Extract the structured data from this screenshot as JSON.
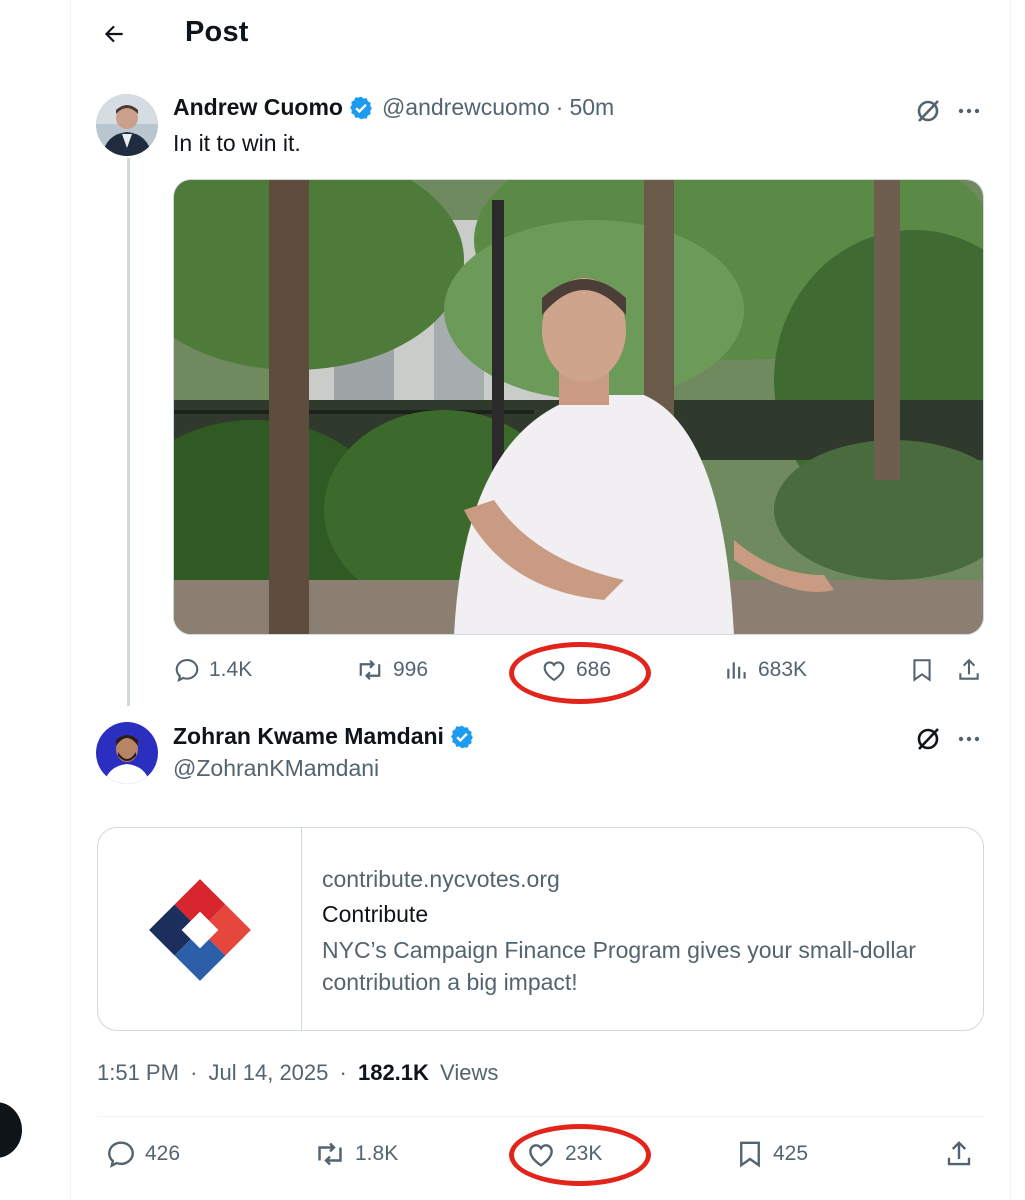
{
  "header": {
    "title": "Post"
  },
  "tweet1": {
    "name": "Andrew Cuomo",
    "handle": "@andrewcuomo",
    "separator": "·",
    "time": "50m",
    "text": "In it to win it.",
    "stats": {
      "replies": "1.4K",
      "reposts": "996",
      "likes": "686",
      "views": "683K"
    }
  },
  "tweet2": {
    "name": "Zohran Kwame Mamdani",
    "handle": "@ZohranKMamdani",
    "card": {
      "domain": "contribute.nycvotes.org",
      "title": "Contribute",
      "description": "NYC’s Campaign Finance Program gives your small-dollar contribution a big impact!"
    },
    "time": "1:51 PM",
    "separator": "·",
    "date": "Jul 14, 2025",
    "views_count": "182.1K",
    "views_label": "Views",
    "stats": {
      "replies": "426",
      "reposts": "1.8K",
      "likes": "23K",
      "bookmarks": "425"
    }
  },
  "icons": [
    "back-arrow-icon",
    "verified-badge-icon",
    "grok-icon",
    "more-icon",
    "reply-icon",
    "repost-icon",
    "like-icon",
    "views-icon",
    "bookmark-icon",
    "share-icon"
  ],
  "colors": {
    "verified": "#1d9bf0",
    "text": "#0f1419",
    "muted": "#536471",
    "highlight": "#e3241b",
    "logo_red": "#d7262e",
    "logo_navy": "#1b2e5c",
    "logo_blue": "#2c5fa8"
  }
}
